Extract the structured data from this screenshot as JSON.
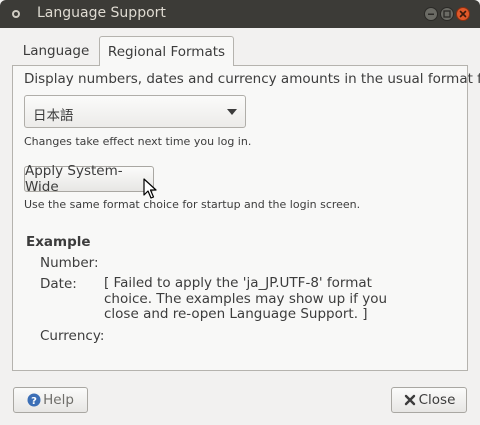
{
  "window": {
    "title": "Language Support"
  },
  "tabs": [
    {
      "label": "Language",
      "active": false
    },
    {
      "label": "Regional Formats",
      "active": true
    }
  ],
  "regional": {
    "description": "Display numbers, dates and currency amounts in the usual format for:",
    "format_select": {
      "value": "日本語"
    },
    "relogin_note": "Changes take effect next time you log in.",
    "apply_button": "Apply System-Wide",
    "apply_note": "Use the same format choice for startup and the login screen.",
    "example": {
      "heading": "Example",
      "number_label": "Number:",
      "date_label": "Date:",
      "date_value_lines": [
        "[ Failed to apply the 'ja_JP.UTF-8' format",
        "choice. The examples may show up if you",
        "close and re-open Language Support. ]"
      ],
      "currency_label": "Currency:"
    }
  },
  "footer": {
    "help_button": "Help",
    "close_button": "Close"
  },
  "colors": {
    "titlebar": "#3c3b37",
    "title_text": "#dfdbd2",
    "close_button": "#e0582a",
    "window_bg": "#f2f1f0",
    "help_icon": "#3c6fb6"
  },
  "icons": {
    "window": "app-icon",
    "minimize": "minimize-icon",
    "maximize": "maximize-icon",
    "close": "close-icon",
    "combo": "chevron-down-icon",
    "help": "help-icon",
    "close_button": "close-x-icon",
    "cursor": "mouse-pointer-icon"
  }
}
